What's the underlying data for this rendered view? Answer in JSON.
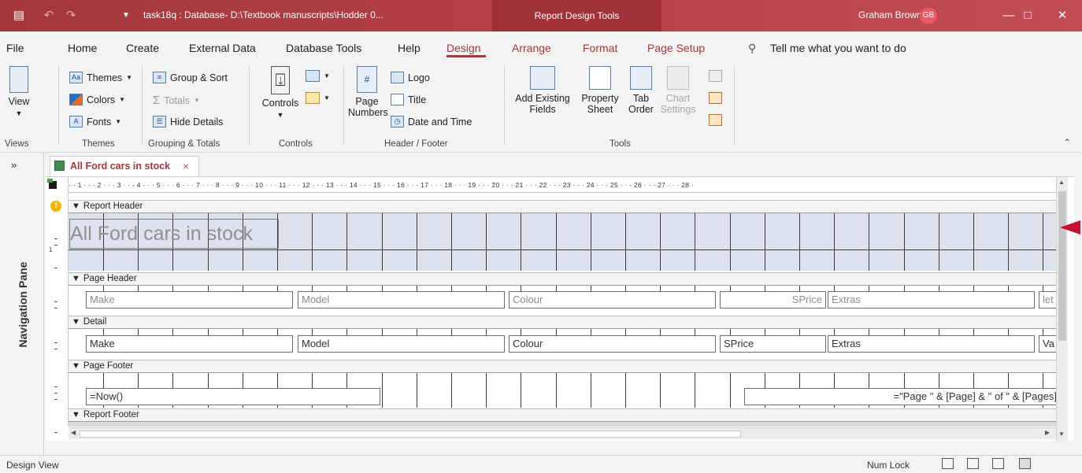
{
  "titlebar": {
    "document": "task18q : Database- D:\\Textbook manuscripts\\Hodder 0...",
    "context_tab": "Report Design Tools",
    "user": "Graham Brown",
    "avatar_initials": "GB",
    "colors": {
      "bar": "#a4373a",
      "accent": "#a4373a"
    }
  },
  "tabs": [
    "File",
    "Home",
    "Create",
    "External Data",
    "Database Tools",
    "Help",
    "Design",
    "Arrange",
    "Format",
    "Page Setup"
  ],
  "active_tab": "Design",
  "tell_me": "Tell me what you want to do",
  "ribbon": {
    "views": {
      "view": "View",
      "label": "Views"
    },
    "themes": {
      "themes": "Themes",
      "colors": "Colors",
      "fonts": "Fonts",
      "label": "Themes"
    },
    "grouping": {
      "group_sort": "Group & Sort",
      "totals": "Totals",
      "hide_details": "Hide Details",
      "label": "Grouping & Totals"
    },
    "controls": {
      "controls": "Controls",
      "label": "Controls"
    },
    "header_footer": {
      "page_numbers_1": "Page",
      "page_numbers_2": "Numbers",
      "logo": "Logo",
      "title": "Title",
      "date_time": "Date and Time",
      "label": "Header / Footer"
    },
    "tools": {
      "add_fields_1": "Add Existing",
      "add_fields_2": "Fields",
      "prop_1": "Property",
      "prop_2": "Sheet",
      "tab_1": "Tab",
      "tab_2": "Order",
      "chart_1": "Chart",
      "chart_2": "Settings",
      "label": "Tools"
    }
  },
  "navigation_pane": {
    "label": "Navigation Pane"
  },
  "document_tab": {
    "label": "All Ford cars in stock",
    "close": "×"
  },
  "ruler": "· · 1 · · · 2 · · · 3 · · · 4 · · · 5 · · · 6 · · · 7 · · · 8 · · · 9 · · · 10 · · · 11 · · · 12 · · · 13 · · · 14 · · · 15 · · · 16 · · · 17 · · · 18 · · · 19 · · · 20 · · · 21 · · · 22 · · · 23 · · · 24 · · · 25 · · · 26 · · · 27 · · · 28 ·",
  "vruler_numbers": [
    "1"
  ],
  "sections": {
    "report_header": "Report Header",
    "page_header": "Page Header",
    "detail": "Detail",
    "page_footer": "Page Footer",
    "report_footer": "Report Footer"
  },
  "report_title": "All Ford cars in stock",
  "page_header_labels": {
    "make": "Make",
    "model": "Model",
    "colour": "Colour",
    "sprice": "SPrice",
    "extras": "Extras",
    "cut": "let"
  },
  "detail_fields": {
    "make": "Make",
    "model": "Model",
    "colour": "Colour",
    "sprice": "SPrice",
    "extras": "Extras",
    "cut": "Va"
  },
  "page_footer_fields": {
    "now": "=Now()",
    "pages": "=\"Page \" & [Page] & \" of \" & [Pages]"
  },
  "status": {
    "text": "Design View",
    "numlock": "Num Lock"
  }
}
